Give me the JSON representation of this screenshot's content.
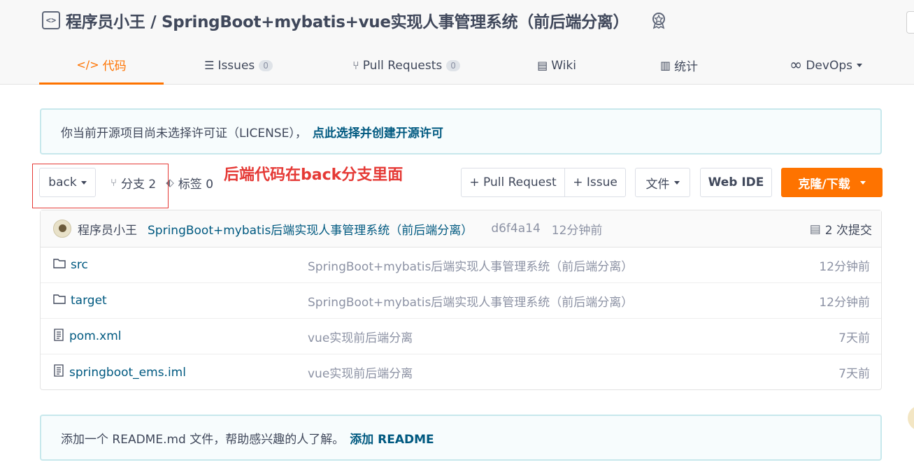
{
  "header": {
    "owner": "程序员小王",
    "separator": " / ",
    "repo_name": "SpringBoot+mybatis+vue实现人事管理系统（前后端分离）"
  },
  "tabs": [
    {
      "label": "代码",
      "icon": "code-icon",
      "active": true
    },
    {
      "label": "Issues",
      "icon": "issues-icon",
      "count": "0"
    },
    {
      "label": "Pull Requests",
      "icon": "pull-request-icon",
      "count": "0"
    },
    {
      "label": "Wiki",
      "icon": "book-icon"
    },
    {
      "label": "统计",
      "icon": "chart-icon"
    },
    {
      "label": "DevOps",
      "icon": "infinity-icon"
    }
  ],
  "license_notice": {
    "text": "你当前开源项目尚未选择许可证（LICENSE），",
    "link": "点此选择并创建开源许可"
  },
  "toolbar": {
    "branch": "back",
    "branches_label": "分支 2",
    "tags_label": "标签 0",
    "annotation": "后端代码在back分支里面",
    "pull_request": "+ Pull Request",
    "issue": "+ Issue",
    "file_menu": "文件",
    "web_ide": "Web IDE",
    "clone": "克隆/下载"
  },
  "commit": {
    "author": "程序员小王",
    "message": "SpringBoot+mybatis后端实现人事管理系统（前后端分离）",
    "hash": "d6f4a14",
    "time": "12分钟前",
    "count_label": "2 次提交"
  },
  "files": [
    {
      "name": "src",
      "type": "folder",
      "message": "SpringBoot+mybatis后端实现人事管理系统（前后端分离）",
      "time": "12分钟前"
    },
    {
      "name": "target",
      "type": "folder",
      "message": "SpringBoot+mybatis后端实现人事管理系统（前后端分离）",
      "time": "12分钟前"
    },
    {
      "name": "pom.xml",
      "type": "file",
      "message": "vue实现前后端分离",
      "time": "7天前"
    },
    {
      "name": "springboot_ems.iml",
      "type": "file",
      "message": "vue实现前后端分离",
      "time": "7天前"
    }
  ],
  "readme_notice": {
    "text": "添加一个 README.md 文件，帮助感兴趣的人了解。",
    "link": "添加 README"
  },
  "colors": {
    "accent": "#fe7300",
    "link": "#005980",
    "annotation": "#e53935"
  }
}
